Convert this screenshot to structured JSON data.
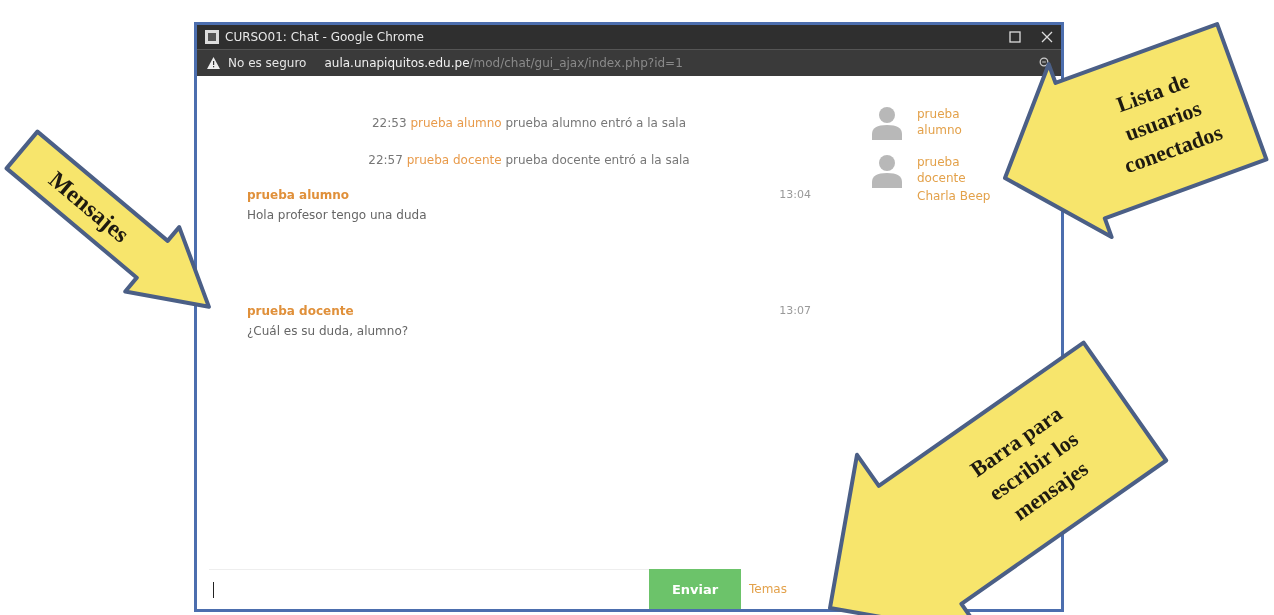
{
  "window": {
    "title": "CURSO01: Chat - Google Chrome"
  },
  "address_bar": {
    "warning": "No es seguro",
    "domain": "aula.unapiquitos.edu.pe",
    "path": "/mod/chat/gui_ajax/index.php?id=1"
  },
  "system_messages": [
    {
      "time": "22:53",
      "user": "prueba alumno",
      "text": "prueba alumno entró a la sala"
    },
    {
      "time": "22:57",
      "user": "prueba docente",
      "text": "prueba docente entró a la sala"
    }
  ],
  "messages": [
    {
      "user": "prueba alumno",
      "time": "13:04",
      "text": "Hola profesor tengo una duda"
    },
    {
      "user": "prueba docente",
      "time": "13:07",
      "text": "¿Cuál es su duda, alumno?"
    }
  ],
  "users": [
    {
      "name": "prueba alumno"
    },
    {
      "name": "prueba docente",
      "action": "Charla Beep"
    }
  ],
  "composer": {
    "send": "Enviar",
    "link": "Temas"
  },
  "callouts": [
    {
      "kind": "messages",
      "text": [
        "Mensajes"
      ]
    },
    {
      "kind": "users",
      "text": [
        "Lista de",
        "usuarios",
        "conectados"
      ]
    },
    {
      "kind": "composer",
      "text": [
        "Barra para",
        "escribir los",
        "mensajes"
      ]
    }
  ]
}
